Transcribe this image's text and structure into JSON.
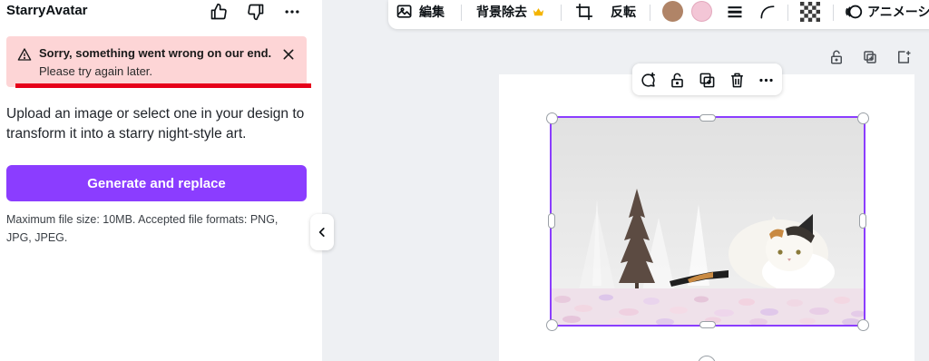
{
  "panel": {
    "app_title": "StarryAvatar",
    "error": {
      "title": "Sorry, something went wrong on our end.",
      "subtitle": "Please try again later."
    },
    "description": "Upload an image or select one in your design to transform it into a starry night-style art.",
    "generate_button": "Generate and replace",
    "hint": "Maximum file size: 10MB. Accepted file formats: PNG, JPG, JPEG."
  },
  "toolbar": {
    "edit_label": "編集",
    "bg_remove_label": "背景除去",
    "flip_label": "反転",
    "animate_label": "アニメーシ",
    "swatch_colors": [
      "#b08467",
      "#f3c6d6"
    ]
  },
  "colors": {
    "accent": "#8b3dff",
    "error_bg": "#fdd5d6",
    "annotation_red": "#e6001a",
    "crown": "#f4b400"
  }
}
